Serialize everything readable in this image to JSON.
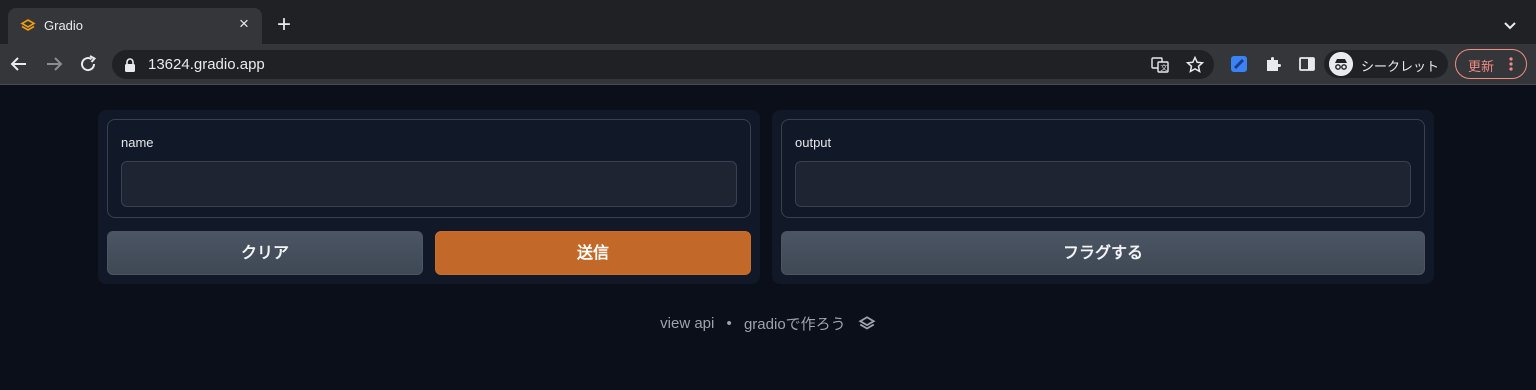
{
  "browser": {
    "tab": {
      "title": "Gradio",
      "close_glyph": "×",
      "favicon": "gradio-logo-icon"
    },
    "new_tab_glyph": "+",
    "address": {
      "url": "13624.gradio.app"
    },
    "incognito_label": "シークレット",
    "update_label": "更新",
    "icons": [
      "back-arrow-icon",
      "forward-arrow-icon",
      "reload-icon",
      "lock-icon",
      "translate-icon",
      "bookmark-star-icon",
      "extension-blue-icon",
      "puzzle-icon",
      "side-panel-icon",
      "incognito-icon",
      "more-vert-icon",
      "chevron-down-icon"
    ]
  },
  "app": {
    "input_panel": {
      "label": "name",
      "value": "",
      "clear_button": "クリア",
      "submit_button": "送信"
    },
    "output_panel": {
      "label": "output",
      "value": "",
      "flag_button": "フラグする"
    },
    "footer": {
      "api_link": "view api",
      "separator": "•",
      "built_with": "gradioで作ろう"
    }
  },
  "colors": {
    "page_bg": "#0b0f19",
    "panel_bg": "#111827",
    "primary": "#c2692a",
    "secondary": "#4b5563"
  }
}
